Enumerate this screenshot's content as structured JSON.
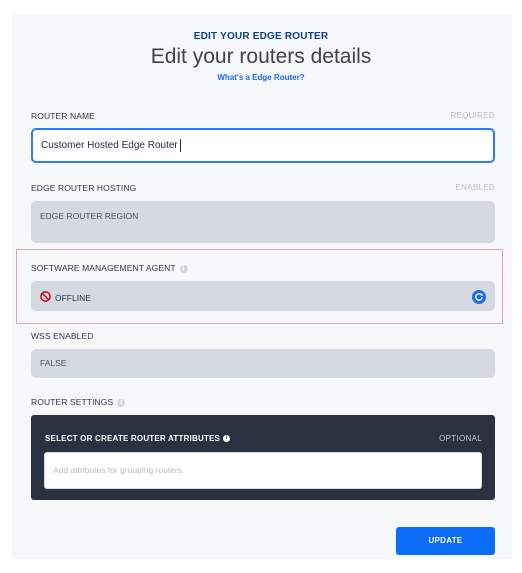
{
  "header": {
    "eyebrow": "EDIT YOUR EDGE ROUTER",
    "title": "Edit your routers details",
    "help_link": "What's a Edge Router?"
  },
  "router_name": {
    "label": "ROUTER NAME",
    "requirement": "REQUIRED",
    "value": "Customer Hosted Edge Router"
  },
  "hosting": {
    "label": "EDGE ROUTER HOSTING",
    "status": "ENABLED",
    "value": "EDGE ROUTER REGION"
  },
  "agent": {
    "label": "SOFTWARE MANAGEMENT AGENT",
    "status": "OFFLINE",
    "status_icon": "prohibited-icon",
    "status_color": "#d0021b",
    "refresh_icon": "refresh-icon"
  },
  "wss": {
    "label": "WSS ENABLED",
    "value": "FALSE"
  },
  "settings": {
    "label": "ROUTER SETTINGS",
    "attributes_title": "SELECT OR CREATE ROUTER ATTRIBUTES",
    "attributes_optional": "OPTIONAL",
    "attributes_placeholder": "Add attributes for grouping routers"
  },
  "actions": {
    "update_label": "UPDATE"
  },
  "colors": {
    "accent": "#0b6cf5",
    "dark_panel": "#2a3140",
    "readonly_bg": "#d5d9e1",
    "highlight_border": "#e6a3b6"
  }
}
